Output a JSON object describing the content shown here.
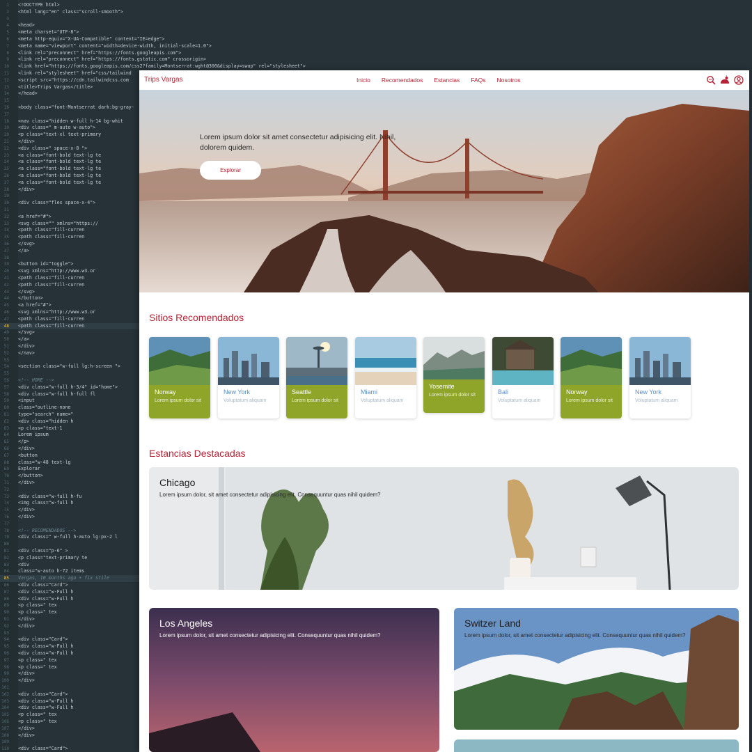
{
  "editor": {
    "lines": [
      {
        "n": "1",
        "t": "<!DOCTYPE html>"
      },
      {
        "n": "2",
        "t": "<html lang=\"en\"  class=\"scroll-smooth\">"
      },
      {
        "n": "3",
        "t": ""
      },
      {
        "n": "4",
        "t": "<head>"
      },
      {
        "n": "5",
        "t": "    <meta charset=\"UTF-8\">"
      },
      {
        "n": "6",
        "t": "    <meta http-equiv=\"X-UA-Compatible\" content=\"IE=edge\">"
      },
      {
        "n": "7",
        "t": "    <meta name=\"viewport\" content=\"width=device-width, initial-scale=1.0\">"
      },
      {
        "n": "8",
        "t": "    <link rel=\"preconnect\" href=\"https://fonts.googleapis.com\">"
      },
      {
        "n": "9",
        "t": "    <link rel=\"preconnect\" href=\"https://fonts.gstatic.com\" crossorigin>"
      },
      {
        "n": "10",
        "t": "    <link href=\"https://fonts.googleapis.com/css2?family=Montserrat:wght@300&display=swap\" rel=\"stylesheet\">"
      },
      {
        "n": "11",
        "t": "    <link rel=\"stylesheet\" href=\"css/tailwind"
      },
      {
        "n": "12",
        "t": "    <script src=\"https://cdn.tailwindcss.com"
      },
      {
        "n": "13",
        "t": "    <title>Trips Vargas</title>"
      },
      {
        "n": "14",
        "t": "</head>"
      },
      {
        "n": "15",
        "t": ""
      },
      {
        "n": "16",
        "t": "<body class=\"font-Montserrat  dark:bg-gray-"
      },
      {
        "n": "17",
        "t": ""
      },
      {
        "n": "18",
        "t": "    <nav class=\"hidden w-full h-14  bg-whit"
      },
      {
        "n": "19",
        "t": "        <div class=\" m-auto w-auto\">"
      },
      {
        "n": "20",
        "t": "            <p class=\"text-xl  text-primary"
      },
      {
        "n": "21",
        "t": "        </div>"
      },
      {
        "n": "22",
        "t": "        <div class=\"  space-x-8 \">"
      },
      {
        "n": "23",
        "t": "            <a class=\"font-bold text-lg  te"
      },
      {
        "n": "24",
        "t": "            <a class=\"font-bold text-lg  te"
      },
      {
        "n": "25",
        "t": "            <a class=\"font-bold text-lg  te"
      },
      {
        "n": "26",
        "t": "            <a class=\"font-bold text-lg  te"
      },
      {
        "n": "27",
        "t": "            <a class=\"font-bold text-lg  te"
      },
      {
        "n": "28",
        "t": "        </div>"
      },
      {
        "n": "29",
        "t": ""
      },
      {
        "n": "30",
        "t": "        <div class=\"flex space-x-4\">"
      },
      {
        "n": "31",
        "t": ""
      },
      {
        "n": "32",
        "t": "            <a href=\"#\">"
      },
      {
        "n": "33",
        "t": "                <svg class=\"\" xmlns=\"https://"
      },
      {
        "n": "34",
        "t": "                    <path class=\"fill-curren"
      },
      {
        "n": "35",
        "t": "                    <path class=\"fill-curren"
      },
      {
        "n": "36",
        "t": "                </svg>"
      },
      {
        "n": "37",
        "t": "            </a>"
      },
      {
        "n": "38",
        "t": ""
      },
      {
        "n": "39",
        "t": "            <button  id=\"toggle\">"
      },
      {
        "n": "40",
        "t": "                <svg xmlns=\"http://www.w3.or"
      },
      {
        "n": "41",
        "t": "                    <path class=\"fill-curren"
      },
      {
        "n": "42",
        "t": "                    <path class=\"fill-curren"
      },
      {
        "n": "43",
        "t": "                </svg>"
      },
      {
        "n": "44",
        "t": "            </button>"
      },
      {
        "n": "45",
        "t": "            <a href=\"#\">"
      },
      {
        "n": "46",
        "t": "                <svg xmlns=\"http://www.w3.or"
      },
      {
        "n": "47",
        "t": "                    <path class=\"fill-curren"
      },
      {
        "n": "48",
        "t": "                    <path class=\"fill-curren"
      },
      {
        "n": "49",
        "t": "                </svg>"
      },
      {
        "n": "50",
        "t": "            </a>"
      },
      {
        "n": "51",
        "t": "        </div>"
      },
      {
        "n": "52",
        "t": "    </nav>"
      },
      {
        "n": "53",
        "t": ""
      },
      {
        "n": "54",
        "t": "    <section class=\"w-full lg:h-screen \">"
      },
      {
        "n": "55",
        "t": ""
      },
      {
        "n": "56",
        "t": "        <!-- HOME -->"
      },
      {
        "n": "57",
        "t": "        <div class=\"w-full h-3/4\" id=\"home\">"
      },
      {
        "n": "58",
        "t": "            <div class=\"w-full h-full fl"
      },
      {
        "n": "59",
        "t": "                <input"
      },
      {
        "n": "60",
        "t": "                    class=\"outline-none"
      },
      {
        "n": "61",
        "t": "                    type=\"search\" name=\""
      },
      {
        "n": "62",
        "t": "                    <div class=\"hidden h"
      },
      {
        "n": "63",
        "t": "                        <p class=\"text-1"
      },
      {
        "n": "64",
        "t": "                            Lorem ipsum"
      },
      {
        "n": "65",
        "t": "                        </p>"
      },
      {
        "n": "66",
        "t": "                    </div>"
      },
      {
        "n": "67",
        "t": "                <button"
      },
      {
        "n": "68",
        "t": "                    class=\"w-48 text-lg"
      },
      {
        "n": "69",
        "t": "                    Explorar"
      },
      {
        "n": "70",
        "t": "                </button>"
      },
      {
        "n": "71",
        "t": "            </div>"
      },
      {
        "n": "72",
        "t": ""
      },
      {
        "n": "73",
        "t": "            <div class=\"w-full h-fu"
      },
      {
        "n": "74",
        "t": "                <img class=\"w-full h"
      },
      {
        "n": "75",
        "t": "            </div>"
      },
      {
        "n": "76",
        "t": "        </div>"
      },
      {
        "n": "77",
        "t": ""
      },
      {
        "n": "78",
        "t": "        <!-- RECOMENDADOS -->"
      },
      {
        "n": "79",
        "t": "        <div class=\" w-full h-auto lg:px-2 l"
      },
      {
        "n": "80",
        "t": ""
      },
      {
        "n": "81",
        "t": "            <div class=\"p-6\" >"
      },
      {
        "n": "82",
        "t": "                <p class=\"text-primary te"
      },
      {
        "n": "83",
        "t": "                <div"
      },
      {
        "n": "84",
        "t": "                    class=\"w-auto h-72 items"
      },
      {
        "n": "85",
        "t": "     Vargas, 10 months ago • fix stile"
      },
      {
        "n": "86",
        "t": "                    <div class=\"Card\">"
      },
      {
        "n": "87",
        "t": "                        <div class=\"w-Full h"
      },
      {
        "n": "88",
        "t": "                        <div class=\"w-Full h"
      },
      {
        "n": "89",
        "t": "                            <p class=\" tex"
      },
      {
        "n": "90",
        "t": "                            <p class=\" tex"
      },
      {
        "n": "91",
        "t": "                        </div>"
      },
      {
        "n": "92",
        "t": "                    </div>"
      },
      {
        "n": "93",
        "t": ""
      },
      {
        "n": "94",
        "t": "                    <div class=\"Card\">"
      },
      {
        "n": "95",
        "t": "                        <div class=\"w-Full h"
      },
      {
        "n": "96",
        "t": "                        <div class=\"w-Full h"
      },
      {
        "n": "97",
        "t": "                            <p class=\" tex"
      },
      {
        "n": "98",
        "t": "                            <p class=\" tex"
      },
      {
        "n": "99",
        "t": "                        </div>"
      },
      {
        "n": "100",
        "t": "                    </div>"
      },
      {
        "n": "101",
        "t": ""
      },
      {
        "n": "102",
        "t": "                    <div class=\"Card\">"
      },
      {
        "n": "103",
        "t": "                        <div class=\"w-Full h"
      },
      {
        "n": "104",
        "t": "                        <div class=\"w-Full h"
      },
      {
        "n": "105",
        "t": "                            <p class=\" tex"
      },
      {
        "n": "106",
        "t": "                            <p class=\" tex"
      },
      {
        "n": "107",
        "t": "                        </div>"
      },
      {
        "n": "108",
        "t": "                    </div>"
      },
      {
        "n": "109",
        "t": ""
      },
      {
        "n": "110",
        "t": "                    <div class=\"Card\">"
      }
    ]
  },
  "site": {
    "brand": "Trips Vargas",
    "nav": [
      "Inicio",
      "Recomendados",
      "Estancias",
      "FAQs",
      "Nosotros"
    ],
    "icons": [
      "search-icon",
      "theme-toggle-icon",
      "user-icon"
    ],
    "accent_color": "#b42335",
    "hero": {
      "text": "Lorem ipsum dolor sit amet consectetur adipisicing elit. Nihil, dolorem quidem.",
      "button": "Explorar"
    },
    "recommended_title": "Sitios Recomendados",
    "cards": [
      {
        "name": "Norway",
        "desc": "Lorem ipsum dolor sit",
        "style": "green"
      },
      {
        "name": "New York",
        "desc": "Voluptatum aliquam",
        "style": "white"
      },
      {
        "name": "Seattle",
        "desc": "Lorem ipsum dolor sit",
        "style": "green"
      },
      {
        "name": "Miami",
        "desc": "Voluptatum aliquam",
        "style": "white"
      },
      {
        "name": "Yosemite",
        "desc": "Lorem ipsum dolor sit",
        "style": "green"
      },
      {
        "name": "Bali",
        "desc": "Voluptatum aliquam",
        "style": "white"
      },
      {
        "name": "Norway",
        "desc": "Lorem ipsum dolor sit",
        "style": "green"
      },
      {
        "name": "New York",
        "desc": "Voluptatum aliquam",
        "style": "white"
      }
    ],
    "stays_title": "Estancias Destacadas",
    "stays": [
      {
        "name": "Chicago",
        "desc": "Lorem ipsum dolor, sit amet consectetur adipisicing elit. Consequuntur quas nihil quidem?"
      },
      {
        "name": "Los Angeles",
        "desc": "Lorem ipsum dolor, sit amet consectetur adipisicing elit. Consequuntur quas nihil quidem?"
      },
      {
        "name": "Switzer Land",
        "desc": "Lorem ipsum dolor, sit amet consectetur adipisicing elit. Consequuntur quas nihil quidem?"
      }
    ]
  }
}
